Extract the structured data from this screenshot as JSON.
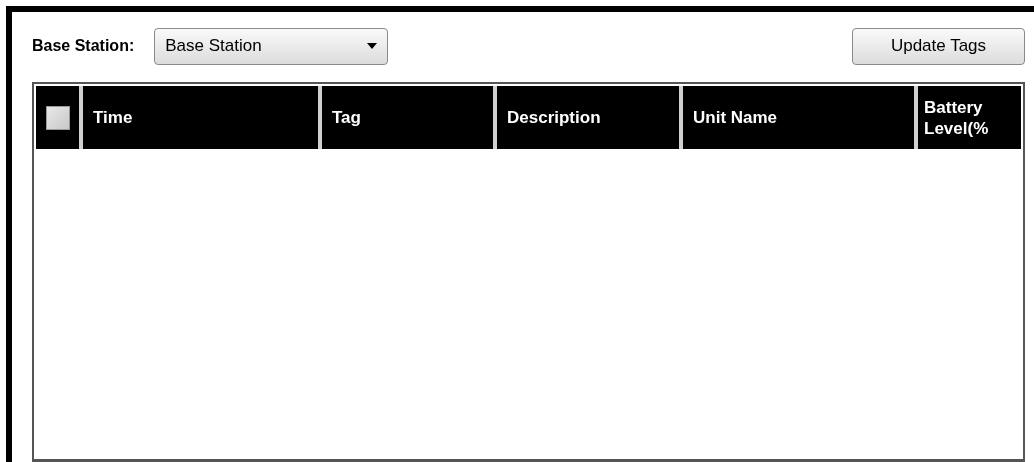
{
  "toolbar": {
    "label": "Base Station:",
    "select": {
      "value": "Base Station"
    },
    "button": "Update Tags"
  },
  "table": {
    "select_all": {
      "checked": false
    },
    "columns": [
      {
        "label": "Time"
      },
      {
        "label": "Tag"
      },
      {
        "label": "Description"
      },
      {
        "label": "Unit Name"
      },
      {
        "label": "Battery Level(%"
      }
    ]
  }
}
